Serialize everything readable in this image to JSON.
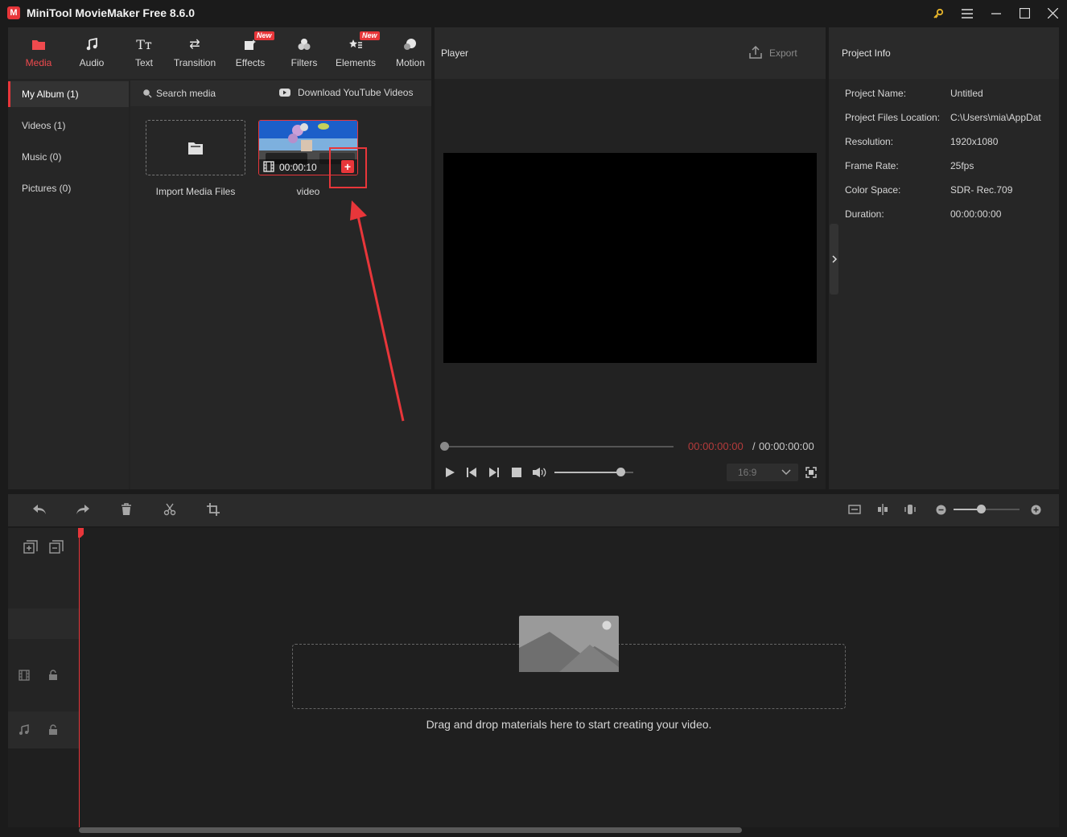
{
  "app": {
    "logo": "M",
    "title": "MiniTool MovieMaker Free 8.6.0"
  },
  "window_controls": {
    "key_icon": "key-icon",
    "menu_icon": "menu-icon",
    "minimize_icon": "minimize-icon",
    "maximize_icon": "maximize-icon",
    "close_icon": "close-icon"
  },
  "toolbar": {
    "tabs": [
      {
        "label": "Media",
        "icon": "folder-icon",
        "active": true
      },
      {
        "label": "Audio",
        "icon": "music-note-icon"
      },
      {
        "label": "Text",
        "icon": "text-icon"
      },
      {
        "label": "Transition",
        "icon": "swap-arrows-icon"
      },
      {
        "label": "Effects",
        "icon": "effects-icon",
        "badge": "New"
      },
      {
        "label": "Filters",
        "icon": "filters-icon"
      },
      {
        "label": "Elements",
        "icon": "elements-icon",
        "badge": "New"
      },
      {
        "label": "Motion",
        "icon": "motion-icon"
      }
    ]
  },
  "album": {
    "items": [
      {
        "label": "My Album (1)",
        "active": true
      },
      {
        "label": "Videos (1)"
      },
      {
        "label": "Music (0)"
      },
      {
        "label": "Pictures (0)"
      }
    ]
  },
  "media": {
    "search_placeholder": "Search media",
    "download_label": "Download YouTube Videos",
    "import_label": "Import Media Files",
    "clip": {
      "name": "video",
      "duration": "00:00:10"
    }
  },
  "player": {
    "title": "Player",
    "export_label": "Export",
    "current_time": "00:00:00:00",
    "separator": "/",
    "total_time": "00:00:00:00",
    "aspect_ratio": "16:9",
    "volume_level": 0.84
  },
  "project_info": {
    "title": "Project Info",
    "rows": [
      {
        "key": "Project Name:",
        "value": "Untitled"
      },
      {
        "key": "Project Files Location:",
        "value": "C:\\Users\\mia\\AppDat"
      },
      {
        "key": "Resolution:",
        "value": "1920x1080"
      },
      {
        "key": "Frame Rate:",
        "value": "25fps"
      },
      {
        "key": "Color Space:",
        "value": "SDR- Rec.709"
      },
      {
        "key": "Duration:",
        "value": "00:00:00:00"
      }
    ]
  },
  "timeline": {
    "dropzone_text": "Drag and drop materials here to start creating your video.",
    "zoom_level": 0.42
  },
  "colors": {
    "accent": "#e8363a",
    "panel": "#262626",
    "background": "#1b1b1b"
  }
}
